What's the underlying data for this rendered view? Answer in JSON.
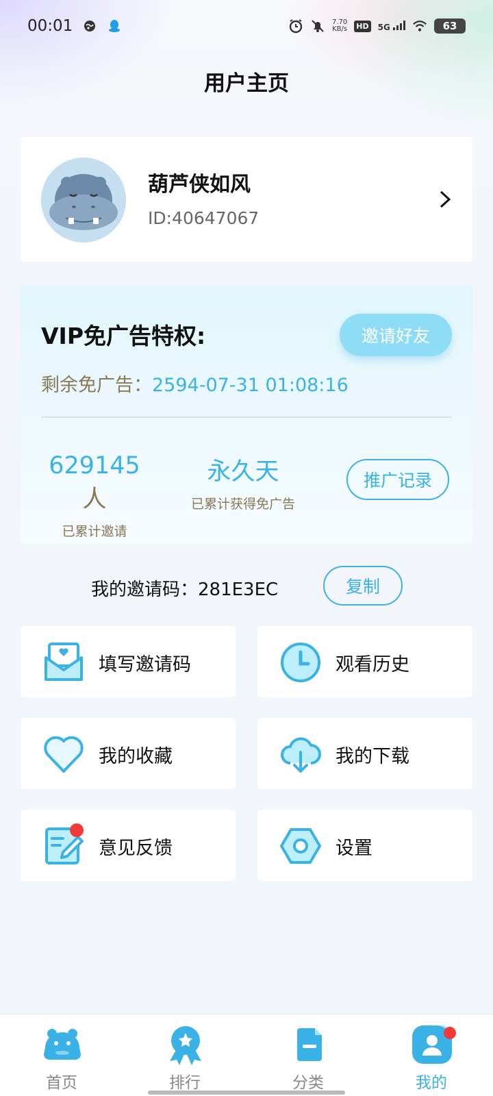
{
  "status_bar": {
    "time": "00:01",
    "net_speed_value": "7.70",
    "net_speed_unit": "KB/s",
    "hd_label": "HD",
    "network_label": "5G",
    "battery": "63"
  },
  "header": {
    "title": "用户主页"
  },
  "profile": {
    "name": "葫芦侠如风",
    "id_text": "ID:40647067"
  },
  "vip": {
    "title": "VIP免广告特权:",
    "invite_button": "邀请好友",
    "remaining_label": "剩余免广告：",
    "remaining_value": "2594-07-31 01:08:16",
    "invited_count": "629145",
    "invited_unit": "人",
    "invited_label": "已累计邀请",
    "adfree_value": "永久天",
    "adfree_label": "已累计获得免广告",
    "promo_button": "推广记录"
  },
  "invite_code": {
    "label": "我的邀请码：281E3EC",
    "copy_button": "复制"
  },
  "menu": {
    "fill_code": "填写邀请码",
    "history": "观看历史",
    "favorites": "我的收藏",
    "downloads": "我的下载",
    "feedback": "意见反馈",
    "settings": "设置"
  },
  "tabs": [
    {
      "label": "首页",
      "icon": "hippo-home-icon"
    },
    {
      "label": "排行",
      "icon": "award-ribbon-icon"
    },
    {
      "label": "分类",
      "icon": "category-icon"
    },
    {
      "label": "我的",
      "icon": "user-profile-icon"
    }
  ],
  "colors": {
    "accent": "#3ab2e6",
    "label_brown": "#8a7856",
    "badge_red": "#f23a3a"
  }
}
